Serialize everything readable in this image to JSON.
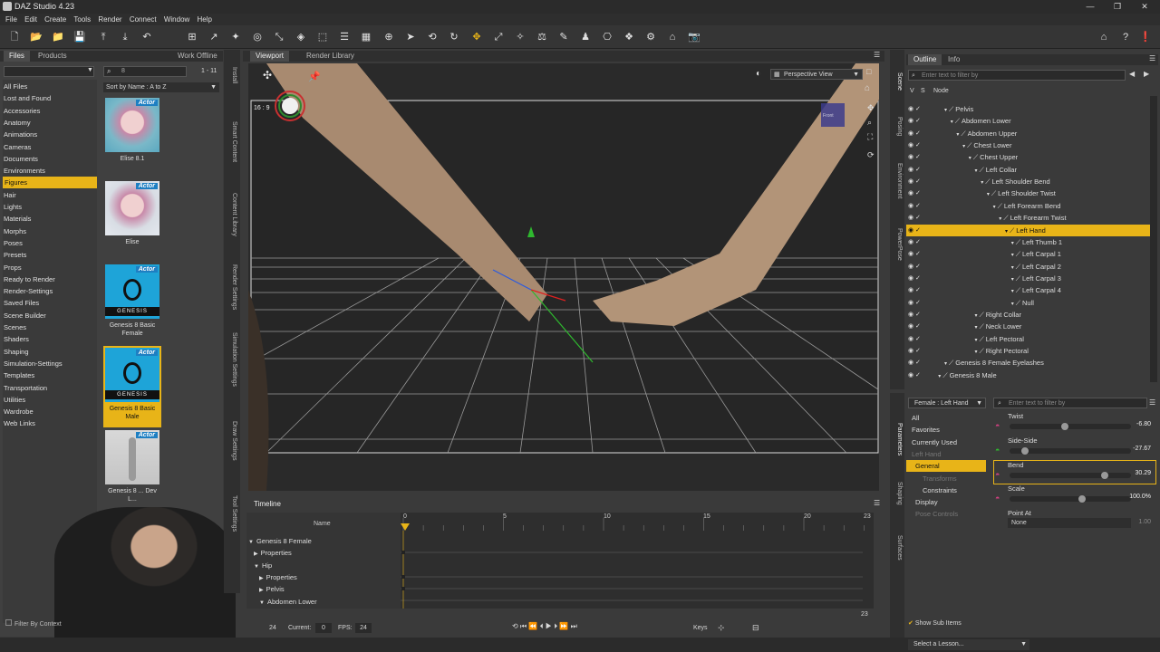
{
  "app": {
    "title": "DAZ Studio 4.23"
  },
  "menu": [
    "File",
    "Edit",
    "Create",
    "Tools",
    "Render",
    "Connect",
    "Window",
    "Help"
  ],
  "left_panel": {
    "tabs": [
      "Files",
      "Products"
    ],
    "work_offline": "Work Offline",
    "search_placeholder": "",
    "page_count": "1 - 11",
    "sort": "Sort by Name : A to Z",
    "categories": [
      "All Files",
      "Lost and Found",
      "Accessories",
      "Anatomy",
      "Animations",
      "Cameras",
      "Documents",
      "Environments",
      "Figures",
      "Hair",
      "Lights",
      "Materials",
      "Morphs",
      "Poses",
      "Presets",
      "Props",
      "Ready to Render",
      "Render-Settings",
      "Saved Files",
      "Scene Builder",
      "Scenes",
      "Shaders",
      "Shaping",
      "Simulation-Settings",
      "Templates",
      "Transportation",
      "Utilities",
      "Wardrobe",
      "Web Links"
    ],
    "selected_category": "Figures",
    "items": [
      {
        "caption": "Elise 8.1",
        "badge": "Actor"
      },
      {
        "caption": "Elise",
        "badge": "Actor"
      },
      {
        "caption": "Genesis 8 Basic Female",
        "badge": "Actor",
        "brand": "GENESIS"
      },
      {
        "caption": "Genesis 8 Basic Male",
        "badge": "Actor",
        "brand": "GENESIS"
      },
      {
        "caption": "Genesis 8 ... Dev L...",
        "badge": "Actor"
      }
    ],
    "filter_context": "Filter By Context"
  },
  "side_tabs_left": [
    "Install",
    "Smart Content",
    "Content Library",
    "Render Settings",
    "Simulation Settings",
    "Draw Settings",
    "Tool Settings"
  ],
  "viewport": {
    "tabs": [
      "Viewport",
      "Render Library"
    ],
    "view_name": "Perspective View",
    "aspect": "16 : 9",
    "cube_label": "Front"
  },
  "timeline": {
    "title": "Timeline",
    "name_header": "Name",
    "ticks": [
      "0",
      "5",
      "10",
      "15",
      "20",
      "23"
    ],
    "rows": [
      "Genesis 8 Female",
      "Properties",
      "Hip",
      "Properties",
      "Pelvis",
      "Abdomen Lower"
    ],
    "footer": {
      "start": "24",
      "current_label": "Current:",
      "current": "0",
      "fps_label": "FPS:",
      "fps": "24",
      "keys_label": "Keys",
      "end": "23"
    }
  },
  "scene": {
    "tabs": [
      "Outline",
      "Info"
    ],
    "filter_placeholder": "Enter text to filter by",
    "header_v": "V",
    "header_s": "S",
    "header_node": "Node",
    "nodes": [
      {
        "label": "Pelvis",
        "indent": 0
      },
      {
        "label": "Abdomen Lower",
        "indent": 1
      },
      {
        "label": "Abdomen Upper",
        "indent": 2
      },
      {
        "label": "Chest Lower",
        "indent": 3
      },
      {
        "label": "Chest Upper",
        "indent": 4
      },
      {
        "label": "Left Collar",
        "indent": 5
      },
      {
        "label": "Left Shoulder Bend",
        "indent": 6
      },
      {
        "label": "Left Shoulder Twist",
        "indent": 7
      },
      {
        "label": "Left Forearm Bend",
        "indent": 8
      },
      {
        "label": "Left Forearm Twist",
        "indent": 9
      },
      {
        "label": "Left Hand",
        "indent": 10
      },
      {
        "label": "Left Thumb 1",
        "indent": 11
      },
      {
        "label": "Left Carpal 1",
        "indent": 11
      },
      {
        "label": "Left Carpal 2",
        "indent": 11
      },
      {
        "label": "Left Carpal 3",
        "indent": 11
      },
      {
        "label": "Left Carpal 4",
        "indent": 11
      },
      {
        "label": "Null",
        "indent": 11
      },
      {
        "label": "Right Collar",
        "indent": 5
      },
      {
        "label": "Neck Lower",
        "indent": 5
      },
      {
        "label": "Left Pectoral",
        "indent": 5
      },
      {
        "label": "Right Pectoral",
        "indent": 5
      },
      {
        "label": "Genesis 8 Female Eyelashes",
        "indent": 0
      },
      {
        "label": "Genesis 8 Male",
        "indent": -1
      }
    ],
    "selected": "Left Hand"
  },
  "side_tabs_right": [
    "Scene",
    "Posing",
    "Environment",
    "PowerPose"
  ],
  "parameters": {
    "node_select": "Female : Left Hand",
    "filter_placeholder": "Enter text to filter by",
    "groups": [
      "All",
      "Favorites",
      "Currently Used",
      "Left Hand",
      "General",
      "Transforms",
      "Constraints",
      "Display",
      "Pose Controls"
    ],
    "selected_group": "General",
    "params": [
      {
        "label": "Twist",
        "value": "-6.80",
        "pos": 0.45
      },
      {
        "label": "Side-Side",
        "value": "-27.67",
        "pos": 0.1
      },
      {
        "label": "Bend",
        "value": "30.29",
        "pos": 0.8
      },
      {
        "label": "Scale",
        "value": "100.0%",
        "pos": 0.6
      },
      {
        "label": "Point At",
        "value": "None",
        "pos": 0
      }
    ],
    "point_at_extra": "1.00",
    "show_sub_items": "Show Sub Items"
  },
  "side_tabs_params": [
    "Parameters",
    "Shaping",
    "Surfaces"
  ],
  "footer": {
    "lesson": "Select a Lesson..."
  },
  "colors": {
    "accent": "#e8b418",
    "bg": "#3a3a3a",
    "panel": "#404040",
    "viewport": "#2a2a2a"
  }
}
